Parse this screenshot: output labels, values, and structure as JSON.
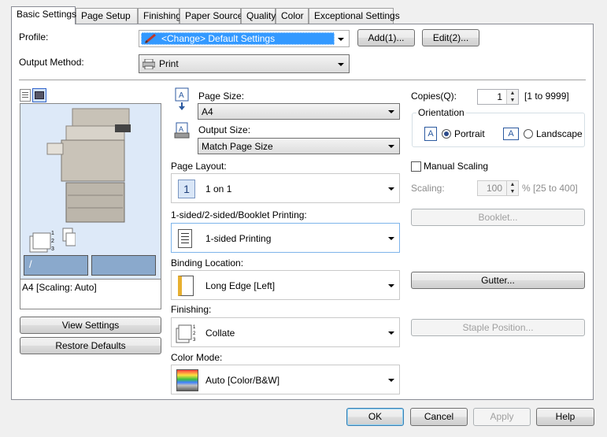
{
  "tabs": [
    "Basic Settings",
    "Page Setup",
    "Finishing",
    "Paper Source",
    "Quality",
    "Color",
    "Exceptional Settings"
  ],
  "profile": {
    "label": "Profile:",
    "value": "<Change> Default Settings",
    "add": "Add(1)...",
    "edit": "Edit(2)..."
  },
  "output_method": {
    "label": "Output Method:",
    "value": "Print"
  },
  "preview": {
    "status": "A4 [Scaling: Auto]",
    "view_settings": "View Settings",
    "restore_defaults": "Restore Defaults"
  },
  "page_size": {
    "label": "Page Size:",
    "value": "A4"
  },
  "output_size": {
    "label": "Output Size:",
    "value": "Match Page Size"
  },
  "page_layout": {
    "label": "Page Layout:",
    "value": "1 on 1"
  },
  "sided": {
    "label": "1-sided/2-sided/Booklet Printing:",
    "value": "1-sided Printing"
  },
  "binding": {
    "label": "Binding Location:",
    "value": "Long Edge [Left]"
  },
  "finishing": {
    "label": "Finishing:",
    "value": "Collate"
  },
  "color_mode": {
    "label": "Color Mode:",
    "value": "Auto [Color/B&W]"
  },
  "copies": {
    "label": "Copies(Q):",
    "value": "1",
    "range": "[1 to 9999]"
  },
  "orientation": {
    "label": "Orientation",
    "portrait": "Portrait",
    "landscape": "Landscape",
    "selected": "Portrait"
  },
  "manual_scaling": {
    "label": "Manual Scaling",
    "checked": false
  },
  "scaling": {
    "label": "Scaling:",
    "value": "100",
    "range": "% [25 to 400]"
  },
  "booklet_button": "Booklet...",
  "gutter_button": "Gutter...",
  "staple_button": "Staple Position...",
  "footer": {
    "ok": "OK",
    "cancel": "Cancel",
    "apply": "Apply",
    "help": "Help"
  },
  "colors": {
    "selection": "#3399ff",
    "panel": "#ffffff",
    "preview_bg": "#dde9f8"
  }
}
